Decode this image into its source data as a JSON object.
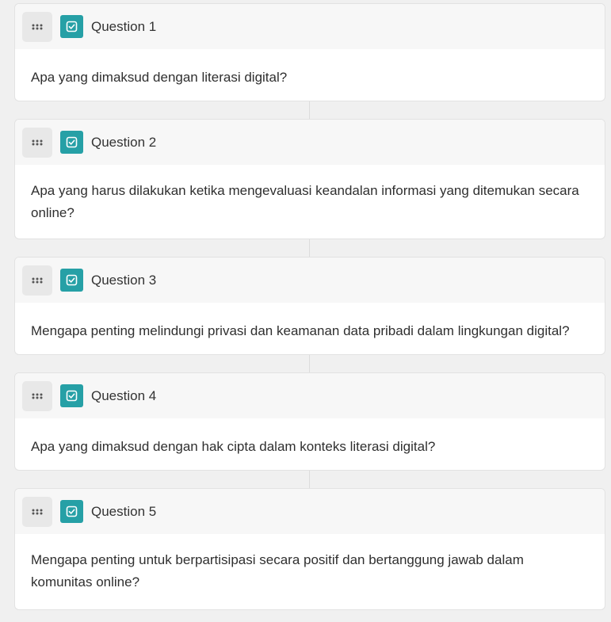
{
  "colors": {
    "background": "#f0f0f0",
    "card": "#ffffff",
    "header": "#f7f7f7",
    "accent": "#26a0a6",
    "handle": "#e8e8e8"
  },
  "icons": {
    "drag": "drag-dots-icon",
    "type": "checkbox-check-icon"
  },
  "questions": [
    {
      "title": "Question 1",
      "text": "Apa yang dimaksud dengan literasi digital?"
    },
    {
      "title": "Question 2",
      "text": "Apa yang harus dilakukan ketika mengevaluasi keandalan informasi yang ditemukan secara online?"
    },
    {
      "title": "Question 3",
      "text": "Mengapa penting melindungi privasi dan keamanan data pribadi dalam lingkungan digital?"
    },
    {
      "title": "Question 4",
      "text": "Apa yang dimaksud dengan hak cipta dalam konteks literasi digital?"
    },
    {
      "title": "Question 5",
      "text": "Mengapa penting untuk berpartisipasi secara positif dan bertanggung jawab dalam komunitas online?"
    }
  ]
}
